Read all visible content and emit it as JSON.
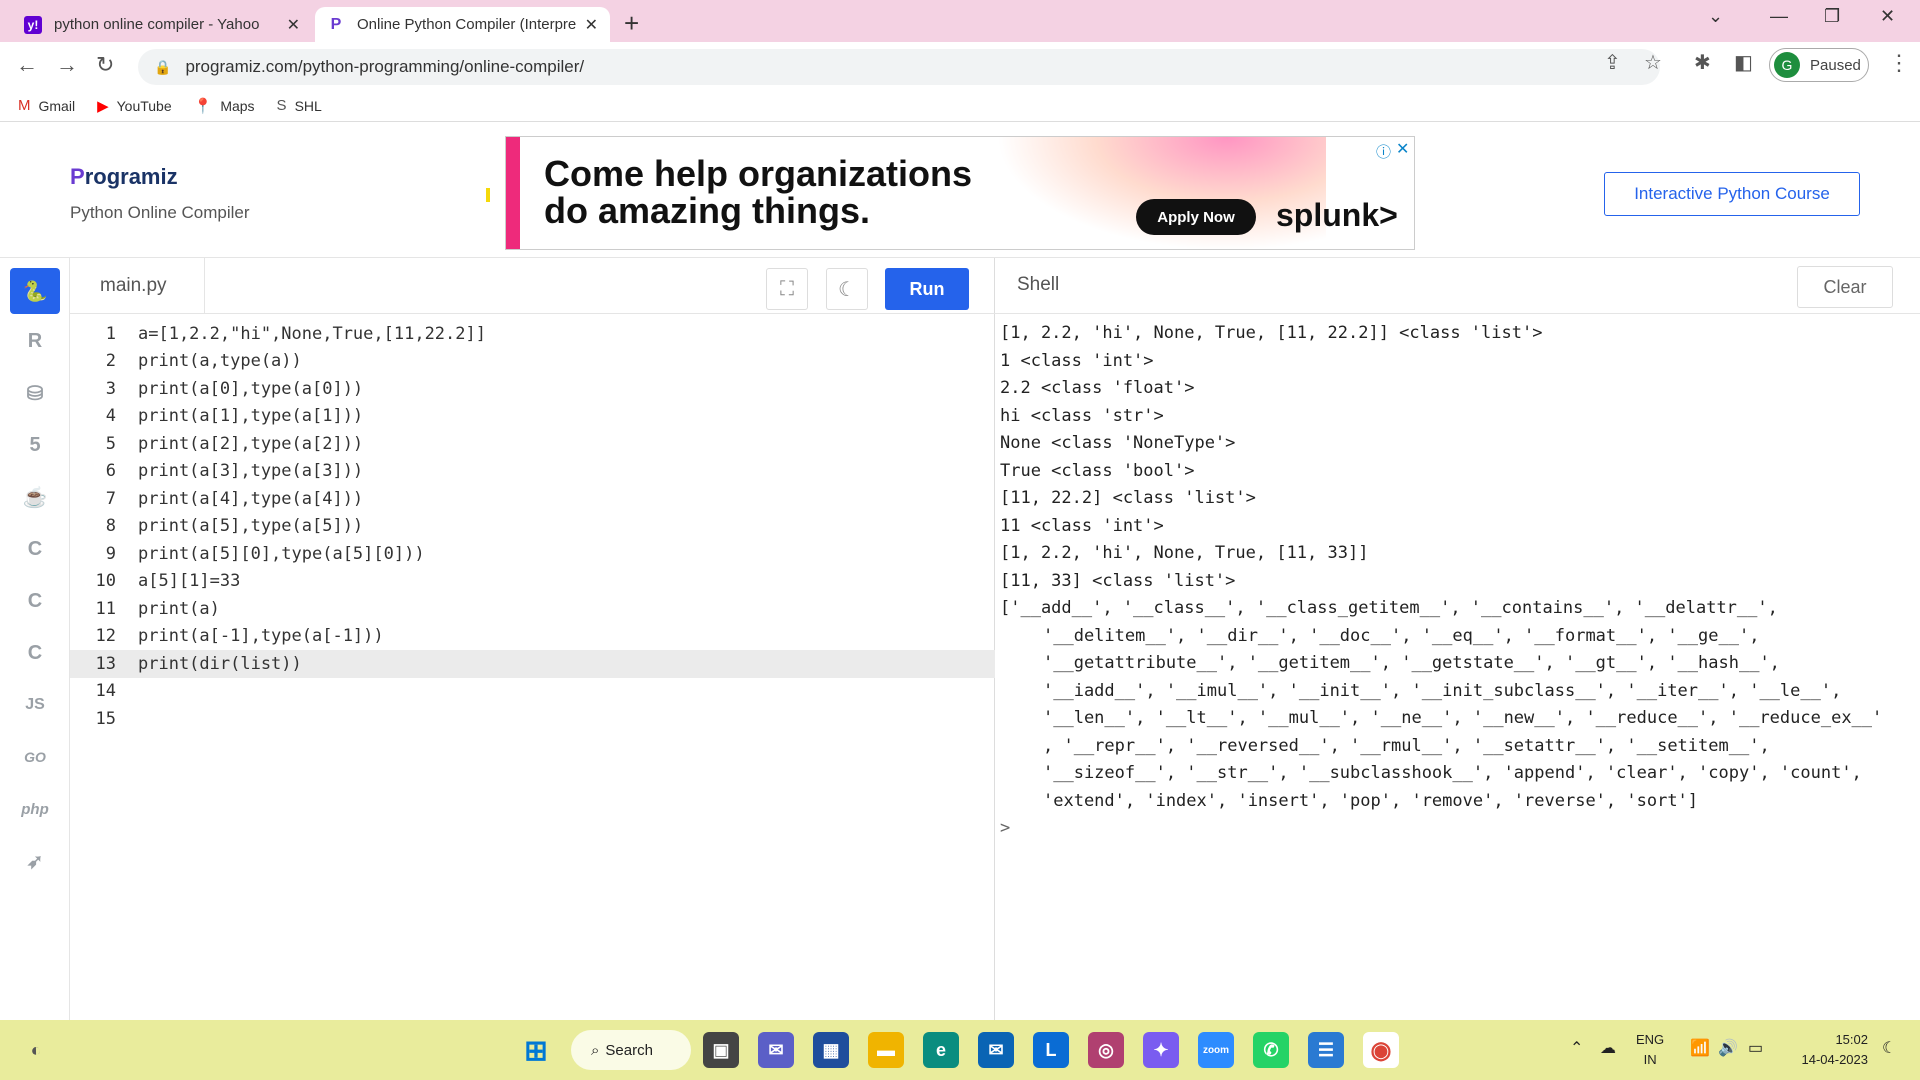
{
  "browser": {
    "tabs": [
      {
        "title": "python online compiler - Yahoo",
        "favicon": "yahoo-icon"
      },
      {
        "title": "Online Python Compiler (Interpre",
        "favicon": "programiz-icon"
      }
    ],
    "url": "programiz.com/python-programming/online-compiler/",
    "profile_initial": "G",
    "profile_status": "Paused",
    "bookmarks": [
      {
        "label": "Gmail",
        "icon": "gmail-icon"
      },
      {
        "label": "YouTube",
        "icon": "youtube-icon"
      },
      {
        "label": "Maps",
        "icon": "maps-icon"
      },
      {
        "label": "SHL",
        "icon": "shl-icon"
      }
    ]
  },
  "site": {
    "logo": "rogramiz",
    "logo_initial": "P",
    "subtitle": "Python Online Compiler",
    "course_button": "Interactive Python Course",
    "ad": {
      "headline": "Come help organizations do amazing things.",
      "cta": "Apply Now",
      "brand": "splunk>"
    }
  },
  "languages": [
    "python",
    "r",
    "sql",
    "html5",
    "java",
    "c",
    "cpp",
    "csharp",
    "js",
    "go",
    "php",
    "swift"
  ],
  "editor": {
    "filename": "main.py",
    "run_label": "Run",
    "current_line": 13,
    "lines": [
      "a=[1,2.2,\"hi\",None,True,[11,22.2]]",
      "print(a,type(a))",
      "print(a[0],type(a[0]))",
      "print(a[1],type(a[1]))",
      "print(a[2],type(a[2]))",
      "print(a[3],type(a[3]))",
      "print(a[4],type(a[4]))",
      "print(a[5],type(a[5]))",
      "print(a[5][0],type(a[5][0]))",
      "a[5][1]=33",
      "print(a)",
      "print(a[-1],type(a[-1]))",
      "print(dir(list))",
      "",
      ""
    ]
  },
  "shell": {
    "title": "Shell",
    "clear_label": "Clear",
    "output": [
      "[1, 2.2, 'hi', None, True, [11, 22.2]] <class 'list'>",
      "1 <class 'int'>",
      "2.2 <class 'float'>",
      "hi <class 'str'>",
      "None <class 'NoneType'>",
      "True <class 'bool'>",
      "[11, 22.2] <class 'list'>",
      "11 <class 'int'>",
      "[1, 2.2, 'hi', None, True, [11, 33]]",
      "[11, 33] <class 'list'>",
      "['__add__', '__class__', '__class_getitem__', '__contains__', '__delattr__',",
      "'__delitem__', '__dir__', '__doc__', '__eq__', '__format__', '__ge__',",
      "'__getattribute__', '__getitem__', '__getstate__', '__gt__', '__hash__',",
      "'__iadd__', '__imul__', '__init__', '__init_subclass__', '__iter__', '__le__',",
      "'__len__', '__lt__', '__mul__', '__ne__', '__new__', '__reduce__', '__reduce_ex__'",
      ", '__repr__', '__reversed__', '__rmul__', '__setattr__', '__setitem__',",
      "'__sizeof__', '__str__', '__subclasshook__', 'append', 'clear', 'copy', 'count',",
      "'extend', 'index', 'insert', 'pop', 'remove', 'reverse', 'sort']"
    ],
    "prompt": ">"
  },
  "taskbar": {
    "search_label": "Search",
    "lang_line1": "ENG",
    "lang_line2": "IN",
    "time": "15:02",
    "date": "14-04-2023"
  },
  "colors": {
    "accent": "#2563eb",
    "tabbar": "#f4d2e3",
    "taskbar": "#e9ec9c"
  }
}
